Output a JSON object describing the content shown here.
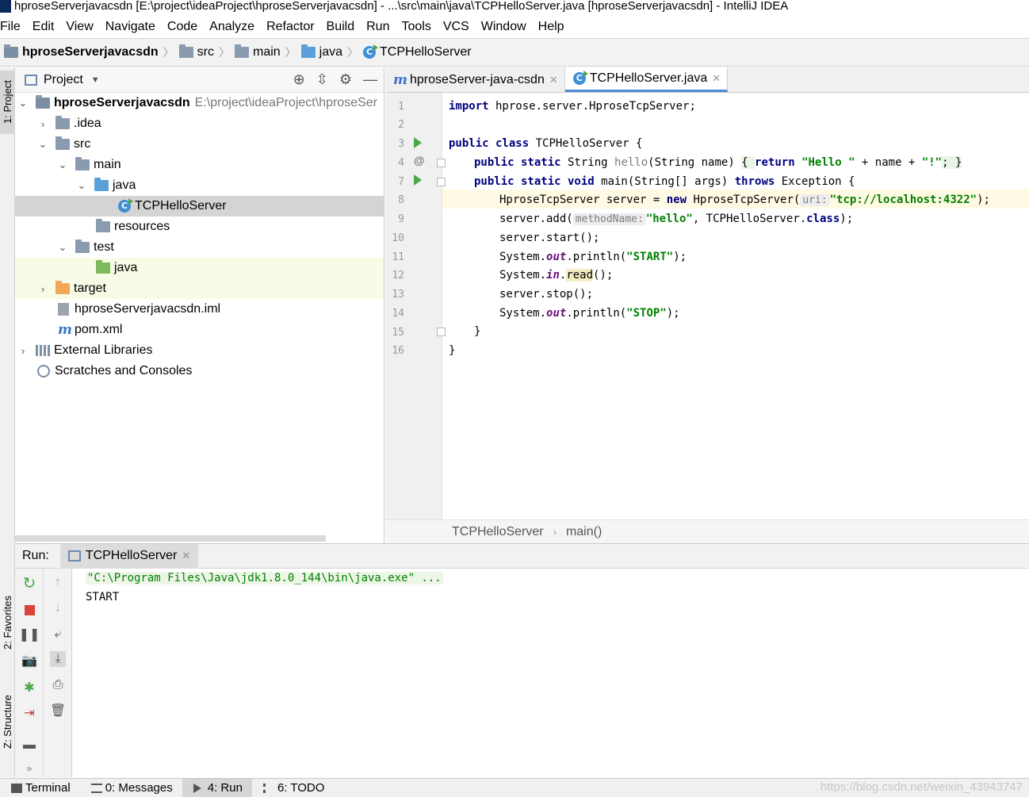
{
  "window": {
    "title": "hproseServerjavacsdn [E:\\project\\ideaProject\\hproseServerjavacsdn] - ...\\src\\main\\java\\TCPHelloServer.java [hproseServerjavacsdn] - IntelliJ IDEA"
  },
  "menu": [
    "File",
    "Edit",
    "View",
    "Navigate",
    "Code",
    "Analyze",
    "Refactor",
    "Build",
    "Run",
    "Tools",
    "VCS",
    "Window",
    "Help"
  ],
  "breadcrumb": [
    "hproseServerjavacsdn",
    "src",
    "main",
    "java",
    "TCPHelloServer"
  ],
  "side_tabs": {
    "project": "1: Project",
    "favorites": "2: Favorites",
    "structure": "Z: Structure"
  },
  "project_panel": {
    "title": "Project",
    "tree": [
      {
        "label": "hproseServerjavacsdn",
        "path": "E:\\project\\ideaProject\\hproseSer"
      },
      {
        "label": ".idea"
      },
      {
        "label": "src"
      },
      {
        "label": "main"
      },
      {
        "label": "java"
      },
      {
        "label": "TCPHelloServer"
      },
      {
        "label": "resources"
      },
      {
        "label": "test"
      },
      {
        "label": "java"
      },
      {
        "label": "target"
      },
      {
        "label": "hproseServerjavacsdn.iml"
      },
      {
        "label": "pom.xml"
      },
      {
        "label": "External Libraries"
      },
      {
        "label": "Scratches and Consoles"
      }
    ]
  },
  "editor": {
    "tabs": [
      {
        "label": "hproseServer-java-csdn",
        "active": false
      },
      {
        "label": "TCPHelloServer.java",
        "active": true
      }
    ],
    "line_numbers": [
      "1",
      "2",
      "3",
      "4",
      "7",
      "8",
      "9",
      "10",
      "11",
      "12",
      "13",
      "14",
      "15",
      "16"
    ],
    "code": {
      "l1_kw": "import",
      "l1_rest": " hprose.server.HproseTcpServer;",
      "l3_kw": "public class",
      "l3_rest": " TCPHelloServer {",
      "l4_kw": "public static",
      "l4_a": " String ",
      "l4_method": "hello",
      "l4_b": "(String name) ",
      "l4_c": "{ ",
      "l4_ret": "return",
      "l4_str": "\"Hello \"",
      "l4_d": " + name + ",
      "l4_str2": "\"!\"",
      "l4_e": "; }",
      "l7_kw": "public static void",
      "l7_a": " main(String[] args) ",
      "l7_throws": "throws",
      "l7_b": " Exception {",
      "l8_a": "HproseTcpServer server = ",
      "l8_new": "new",
      "l8_b": " HproseTcpServer(",
      "l8_hint": "uri:",
      "l8_str": "\"tcp://localhost:4322\"",
      "l8_c": ");",
      "l9_a": "server.add(",
      "l9_hint": "methodName:",
      "l9_str": "\"hello\"",
      "l9_b": ", TCPHelloServer.",
      "l9_cls": "class",
      "l9_c": ");",
      "l10": "server.start();",
      "l11_a": "System.",
      "l11_out": "out",
      "l11_b": ".println(",
      "l11_str": "\"START\"",
      "l11_c": ");",
      "l12_a": "System.",
      "l12_in": "in",
      "l12_b": ".",
      "l12_read": "read",
      "l12_c": "();",
      "l13": "server.stop();",
      "l14_a": "System.",
      "l14_out": "out",
      "l14_b": ".println(",
      "l14_str": "\"STOP\"",
      "l14_c": ");",
      "l15": "}",
      "l16": "}"
    },
    "footer_crumb": [
      "TCPHelloServer",
      "main()"
    ]
  },
  "run_panel": {
    "label": "Run:",
    "tab": "TCPHelloServer",
    "console": [
      "\"C:\\Program Files\\Java\\jdk1.8.0_144\\bin\\java.exe\" ...",
      "START"
    ]
  },
  "status_bar": {
    "items": [
      "Terminal",
      "0: Messages",
      "4: Run",
      "6: TODO"
    ],
    "watermark": "https://blog.csdn.net/weixin_43943747"
  },
  "colors": {
    "keyword": "#000080",
    "string": "#008000",
    "field": "#660e7a",
    "current_line": "#fffae3",
    "selection": "#d4d4d4"
  }
}
